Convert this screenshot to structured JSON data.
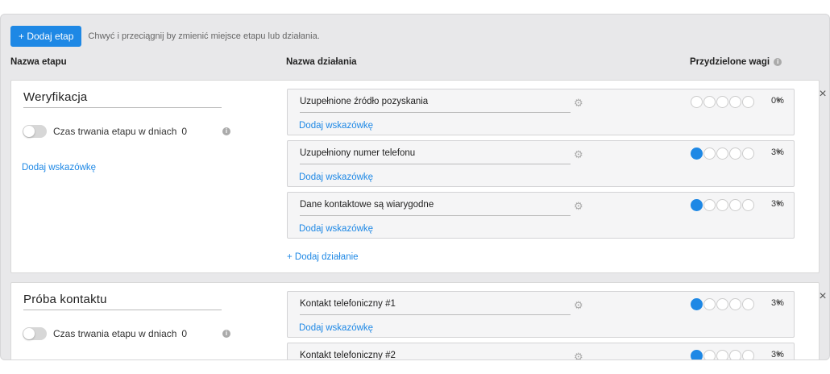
{
  "toolbar": {
    "add_stage_label": "+ Dodaj etap",
    "hint": "Chwyć i przeciągnij by zmienić miejsce etapu lub działania."
  },
  "columns": {
    "stage_name": "Nazwa etapu",
    "action_name": "Nazwa działania",
    "weights": "Przydzielone wagi"
  },
  "stages": [
    {
      "name": "Weryfikacja",
      "duration_label": "Czas trwania etapu w dniach",
      "duration_value": "0",
      "add_hint": "Dodaj wskazówkę",
      "add_action": "+ Dodaj działanie",
      "actions": [
        {
          "name": "Uzupełnione źródło pozyskania",
          "hint": "Dodaj wskazówkę",
          "weight_filled": 0,
          "weight_total": 5,
          "percent": "0%"
        },
        {
          "name": "Uzupełniony numer telefonu",
          "hint": "Dodaj wskazówkę",
          "weight_filled": 1,
          "weight_total": 5,
          "percent": "3%"
        },
        {
          "name": "Dane kontaktowe są wiarygodne",
          "hint": "Dodaj wskazówkę",
          "weight_filled": 1,
          "weight_total": 5,
          "percent": "3%"
        }
      ]
    },
    {
      "name": "Próba kontaktu",
      "duration_label": "Czas trwania etapu w dniach",
      "duration_value": "0",
      "actions": [
        {
          "name": "Kontakt telefoniczny #1",
          "hint": "Dodaj wskazówkę",
          "weight_filled": 1,
          "weight_total": 5,
          "percent": "3%"
        },
        {
          "name": "Kontakt telefoniczny #2",
          "weight_filled": 1,
          "weight_total": 5,
          "percent": "3%"
        }
      ]
    }
  ],
  "colors": {
    "accent": "#1e88e5"
  }
}
